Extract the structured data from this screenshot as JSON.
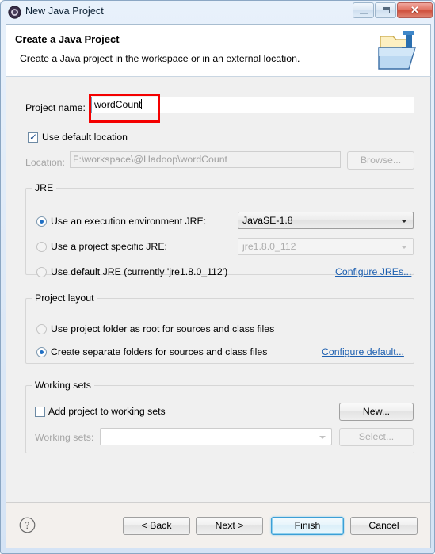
{
  "window": {
    "title": "New Java Project",
    "icon": "eclipse-java-project-icon",
    "controls": {
      "minimize": "minimize",
      "maximize": "restore",
      "close": "✕"
    }
  },
  "header": {
    "title": "Create a Java Project",
    "subtitle": "Create a Java project in the workspace or in an external location.",
    "icon": "java-project-folder-icon"
  },
  "form": {
    "project_name_label": "Project name:",
    "project_name_value": "wordCount",
    "use_default_location_label": "Use default location",
    "use_default_location_checked": true,
    "location_label": "Location:",
    "location_value": "F:\\workspace\\@Hadoop\\wordCount",
    "location_enabled": false,
    "browse_button": "Browse..."
  },
  "jre": {
    "group_title": "JRE",
    "options": [
      {
        "label": "Use an execution environment JRE:",
        "selected": true
      },
      {
        "label": "Use a project specific JRE:",
        "selected": false
      },
      {
        "label": "Use default JRE (currently 'jre1.8.0_112')",
        "selected": false
      }
    ],
    "execution_environment_value": "JavaSE-1.8",
    "project_specific_value": "jre1.8.0_112",
    "configure_link": "Configure JREs..."
  },
  "project_layout": {
    "group_title": "Project layout",
    "options": [
      {
        "label": "Use project folder as root for sources and class files",
        "selected": false
      },
      {
        "label": "Create separate folders for sources and class files",
        "selected": true
      }
    ],
    "configure_link": "Configure default..."
  },
  "working_sets": {
    "group_title": "Working sets",
    "add_label": "Add project to working sets",
    "add_checked": false,
    "working_sets_label": "Working sets:",
    "working_sets_value": "",
    "new_button": "New...",
    "select_button": "Select..."
  },
  "footer": {
    "help_icon": "help-question-icon",
    "back_button": "< Back",
    "next_button": "Next >",
    "finish_button": "Finish",
    "cancel_button": "Cancel",
    "focused_button": "Finish"
  },
  "annotation": {
    "color": "#f40000",
    "target": "project-name-field"
  }
}
